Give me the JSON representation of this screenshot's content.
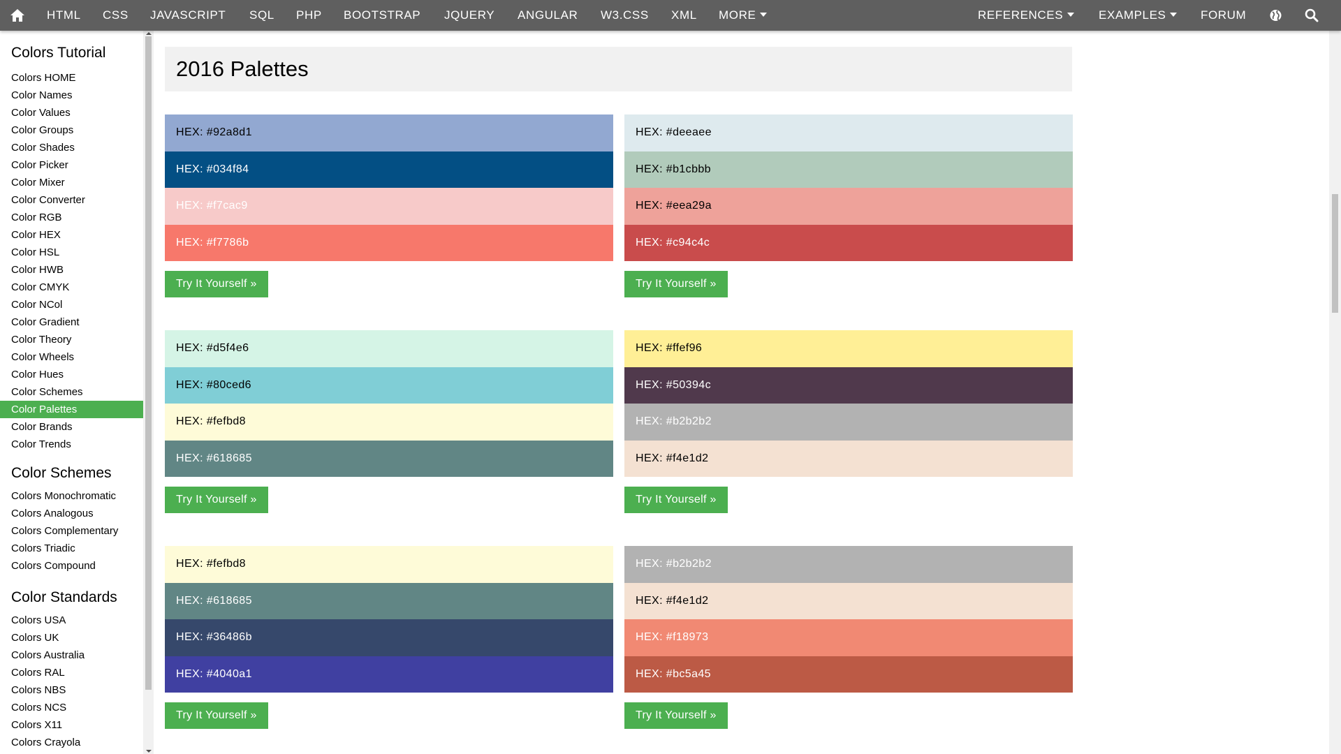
{
  "nav": {
    "items": [
      "HTML",
      "CSS",
      "JAVASCRIPT",
      "SQL",
      "PHP",
      "BOOTSTRAP",
      "JQUERY",
      "ANGULAR",
      "W3.CSS",
      "XML"
    ],
    "more": "MORE",
    "references": "REFERENCES",
    "examples": "EXAMPLES",
    "forum": "FORUM",
    "icons": [
      "home-icon",
      "globe-icon",
      "search-icon"
    ]
  },
  "sidebar": {
    "tutorial_heading": "Colors Tutorial",
    "tutorial_items": [
      "Colors HOME",
      "Color Names",
      "Color Values",
      "Color Groups",
      "Color Shades",
      "Color Picker",
      "Color Mixer",
      "Color Converter",
      "Color RGB",
      "Color HEX",
      "Color HSL",
      "Color HWB",
      "Color CMYK",
      "Color NCol",
      "Color Gradient",
      "Color Theory",
      "Color Wheels",
      "Color Hues",
      "Color Schemes",
      "Color Palettes",
      "Color Brands",
      "Color Trends"
    ],
    "active_item": "Color Palettes",
    "schemes_heading": "Color Schemes",
    "schemes_items": [
      "Colors Monochromatic",
      "Colors Analogous",
      "Colors Complementary",
      "Colors Triadic",
      "Colors Compound"
    ],
    "standards_heading": "Color Standards",
    "standards_items": [
      "Colors USA",
      "Colors UK",
      "Colors Australia",
      "Colors RAL",
      "Colors NBS",
      "Colors NCS",
      "Colors X11",
      "Colors Crayola"
    ]
  },
  "main": {
    "title": "2016 Palettes",
    "try_label": "Try It Yourself »",
    "accent_color": "#4caf50",
    "palettes": [
      {
        "swatches": [
          {
            "label": "HEX: #92a8d1",
            "bg": "#92a8d1",
            "fg": "#000000"
          },
          {
            "label": "HEX: #034f84",
            "bg": "#034f84",
            "fg": "#ffffff"
          },
          {
            "label": "HEX: #f7cac9",
            "bg": "#f7cac9",
            "fg": "#ffffff"
          },
          {
            "label": "HEX: #f7786b",
            "bg": "#f7786b",
            "fg": "#ffffff"
          }
        ]
      },
      {
        "swatches": [
          {
            "label": "HEX: #deeaee",
            "bg": "#deeaee",
            "fg": "#000000"
          },
          {
            "label": "HEX: #b1cbbb",
            "bg": "#b1cbbb",
            "fg": "#000000"
          },
          {
            "label": "HEX: #eea29a",
            "bg": "#eea29a",
            "fg": "#000000"
          },
          {
            "label": "HEX: #c94c4c",
            "bg": "#c94c4c",
            "fg": "#ffffff"
          }
        ]
      },
      {
        "swatches": [
          {
            "label": "HEX: #d5f4e6",
            "bg": "#d5f4e6",
            "fg": "#000000"
          },
          {
            "label": "HEX: #80ced6",
            "bg": "#80ced6",
            "fg": "#000000"
          },
          {
            "label": "HEX: #fefbd8",
            "bg": "#fefbd8",
            "fg": "#000000"
          },
          {
            "label": "HEX: #618685",
            "bg": "#618685",
            "fg": "#ffffff"
          }
        ]
      },
      {
        "swatches": [
          {
            "label": "HEX: #ffef96",
            "bg": "#ffef96",
            "fg": "#000000"
          },
          {
            "label": "HEX: #50394c",
            "bg": "#50394c",
            "fg": "#ffffff"
          },
          {
            "label": "HEX: #b2b2b2",
            "bg": "#b2b2b2",
            "fg": "#ffffff"
          },
          {
            "label": "HEX: #f4e1d2",
            "bg": "#f4e1d2",
            "fg": "#000000"
          }
        ]
      },
      {
        "swatches": [
          {
            "label": "HEX: #fefbd8",
            "bg": "#fefbd8",
            "fg": "#000000"
          },
          {
            "label": "HEX: #618685",
            "bg": "#618685",
            "fg": "#ffffff"
          },
          {
            "label": "HEX: #36486b",
            "bg": "#36486b",
            "fg": "#ffffff"
          },
          {
            "label": "HEX: #4040a1",
            "bg": "#4040a1",
            "fg": "#ffffff"
          }
        ]
      },
      {
        "swatches": [
          {
            "label": "HEX: #b2b2b2",
            "bg": "#b2b2b2",
            "fg": "#ffffff"
          },
          {
            "label": "HEX: #f4e1d2",
            "bg": "#f4e1d2",
            "fg": "#000000"
          },
          {
            "label": "HEX: #f18973",
            "bg": "#f18973",
            "fg": "#ffffff"
          },
          {
            "label": "HEX: #bc5a45",
            "bg": "#bc5a45",
            "fg": "#ffffff"
          }
        ]
      }
    ]
  }
}
